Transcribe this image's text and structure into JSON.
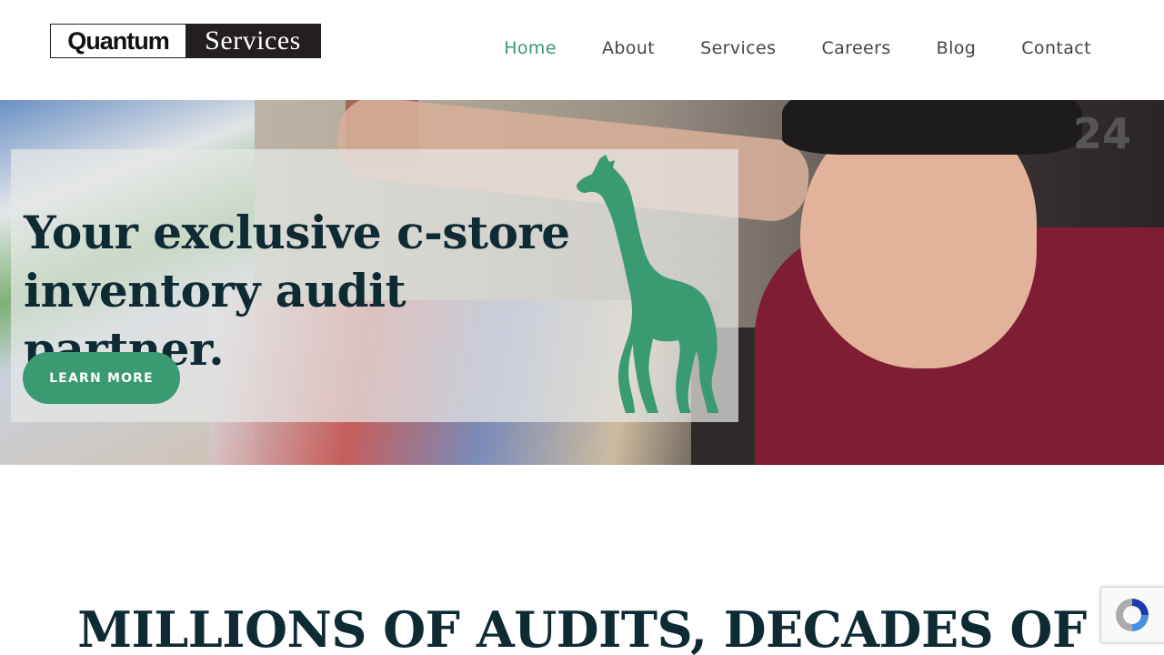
{
  "logo": {
    "left": "Quantum",
    "right": "Services"
  },
  "nav": {
    "items": [
      {
        "label": "Home",
        "active": true
      },
      {
        "label": "About",
        "active": false
      },
      {
        "label": "Services",
        "active": false
      },
      {
        "label": "Careers",
        "active": false
      },
      {
        "label": "Blog",
        "active": false
      },
      {
        "label": "Contact",
        "active": false
      }
    ]
  },
  "hero": {
    "title": "Your exclusive c-store inventory audit partner.",
    "button_label": "LEARN MORE",
    "sign_text": "24",
    "mascot_icon": "giraffe-icon"
  },
  "section": {
    "heading": "MILLIONS OF AUDITS, DECADES OF"
  },
  "recaptcha": {
    "icon": "recaptcha-icon"
  },
  "colors": {
    "accent": "#3a9a72",
    "heading": "#0e2a33",
    "nav_text": "#444444",
    "shirt": "#7e1d34",
    "logo_dark": "#231f20"
  }
}
